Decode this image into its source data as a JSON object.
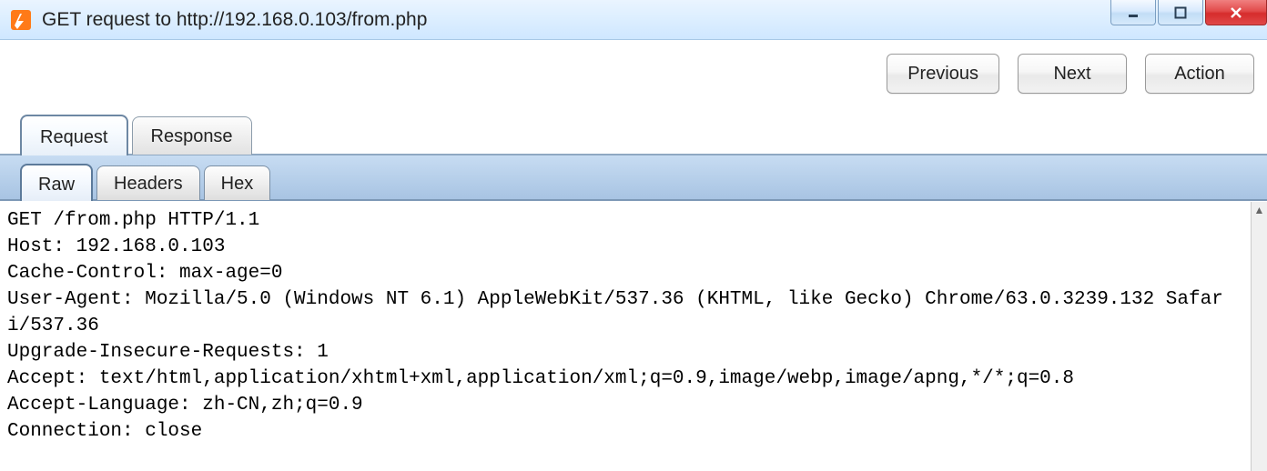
{
  "window": {
    "title": "GET request to http://192.168.0.103/from.php"
  },
  "toolbar": {
    "previous_label": "Previous",
    "next_label": "Next",
    "action_label": "Action"
  },
  "tabs": {
    "request_label": "Request",
    "response_label": "Response",
    "active": "request"
  },
  "subtabs": {
    "raw_label": "Raw",
    "headers_label": "Headers",
    "hex_label": "Hex",
    "active": "raw"
  },
  "request": {
    "raw": "GET /from.php HTTP/1.1\nHost: 192.168.0.103\nCache-Control: max-age=0\nUser-Agent: Mozilla/5.0 (Windows NT 6.1) AppleWebKit/537.36 (KHTML, like Gecko) Chrome/63.0.3239.132 Safari/537.36\nUpgrade-Insecure-Requests: 1\nAccept: text/html,application/xhtml+xml,application/xml;q=0.9,image/webp,image/apng,*/*;q=0.8\nAccept-Language: zh-CN,zh;q=0.9\nConnection: close"
  }
}
